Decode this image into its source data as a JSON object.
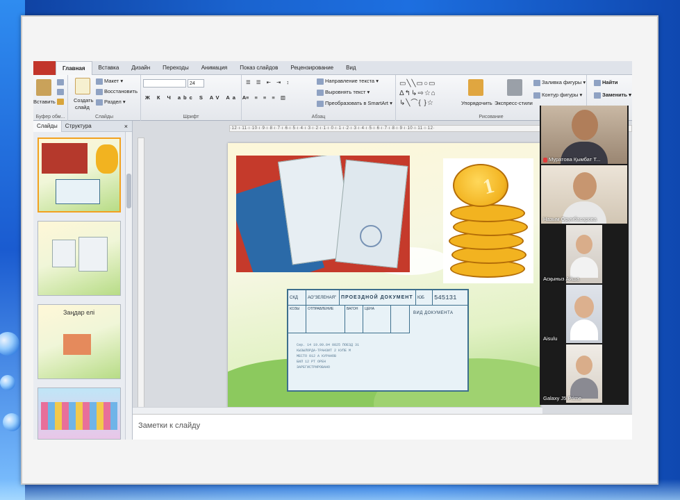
{
  "ribbon_tabs": [
    "Главная",
    "Вставка",
    "Дизайн",
    "Переходы",
    "Анимация",
    "Показ слайдов",
    "Рецензирование",
    "Вид"
  ],
  "ribbon": {
    "clipboard": {
      "paste": "Вставить",
      "label": "Буфер обм..."
    },
    "slides": {
      "create": "Создать",
      "create2": "слайд",
      "layout": "Макет",
      "reset": "Восстановить",
      "section": "Раздел",
      "label": "Слайды"
    },
    "font": {
      "size": "24",
      "label": "Шрифт"
    },
    "paragraph": {
      "text_direction": "Направление текста",
      "align_text": "Выровнять текст",
      "smartart": "Преобразовать в SmartArt",
      "label": "Абзац"
    },
    "drawing": {
      "arrange": "Упорядочить",
      "quick_styles": "Экспресс-стили",
      "fill": "Заливка фигуры",
      "outline": "Контур фигуры",
      "label": "Рисование"
    },
    "editing": {
      "find": "Найти",
      "replace": "Заменить"
    }
  },
  "left_panel": {
    "tab_slides": "Слайды",
    "tab_outline": "Структура",
    "close": "×",
    "thumb3_title": "Заңдар елі"
  },
  "ruler_text": "·12·ı·11·ı·10·ı·9·ı·8·ı·7·ı·6·ı·5·ı·4·ı·3·ı·2·ı·1·ı·0·ı·1·ı·2·ı·3·ı·4·ı·5·ı·6·ı·7·ı·8·ı·9·ı·10·ı·11·ı·12·",
  "notes_placeholder": "Заметки к слайду",
  "ticket": {
    "code": "СКД",
    "airline": "АО\"ЗЕЛЕНАЯ\"",
    "title": "ПРОЕЗДНОЙ ДОКУМЕНТ",
    "series": "ЮБ",
    "number": "545131",
    "col1": "КОЗЫ",
    "col2": "ОТПРАВЛЕНИЕ",
    "col3": "ВАГОН",
    "col4": "ЦЕНА",
    "doc_label": "ВИД ДОКУМЕНТА",
    "lines": "Сер. 14 19.09.04 0825 ПОЕЗД 31\nКЫЗЫЛОРДА-ТРАНЗИТ 2 КУПЕ М\nМЕСТО 012 А КУРАНОВ\nБИЛ 12 РТ ОРЕН\nЗАРЕГИСТРИРОВАНО"
  },
  "participants": [
    {
      "name": "Муратова Қымбат Т...",
      "muted": true
    },
    {
      "name": "Назым Орумбасарова",
      "muted": false
    },
    {
      "name": "Асқыныз Айша",
      "muted": false
    },
    {
      "name": "Aisulu",
      "muted": false
    },
    {
      "name": "Galaxy J5 Prime",
      "muted": false
    }
  ]
}
